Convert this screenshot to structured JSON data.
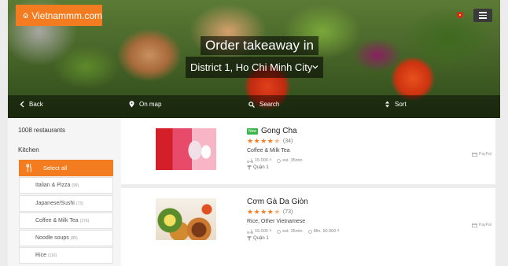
{
  "brand": {
    "name": "Vietnammm.com",
    "accent": "#f47c20"
  },
  "hero": {
    "title": "Order takeaway in",
    "location": "District 1, Ho Chi Minh City",
    "nav": {
      "back": "Back",
      "map": "On map",
      "search": "Search",
      "sort": "Sort"
    }
  },
  "sidebar": {
    "count_label": "1008 restaurants",
    "section_label": "Kitchen",
    "items": [
      {
        "label": "Select all",
        "count": "",
        "active": true
      },
      {
        "label": "Italian & Pizza",
        "count": "(99)"
      },
      {
        "label": "Japanese/Sushi",
        "count": "(73)"
      },
      {
        "label": "Coffee & Milk Tea",
        "count": "(176)"
      },
      {
        "label": "Noodle soups",
        "count": "(85)"
      },
      {
        "label": "Rice",
        "count": "(116)"
      }
    ]
  },
  "restaurants": [
    {
      "badge": "New",
      "name": "Gong Cha",
      "rating": 4.5,
      "reviews": "(34)",
      "cuisine": "Coffee & Milk Tea",
      "delivery_fee": "15.000 ₫",
      "delivery_time": "est. 35min",
      "min_order": "",
      "district": "Quận 1",
      "payment": "PayPal"
    },
    {
      "badge": "",
      "name": "Cơm Gà Da Giòn",
      "rating": 4.5,
      "reviews": "(73)",
      "cuisine": "Rice, Other Vietnamese",
      "delivery_fee": "15.000 ₫",
      "delivery_time": "est. 35min",
      "min_order": "Min. 50.000 ₫",
      "district": "Quận 1",
      "payment": "PayPal"
    }
  ]
}
